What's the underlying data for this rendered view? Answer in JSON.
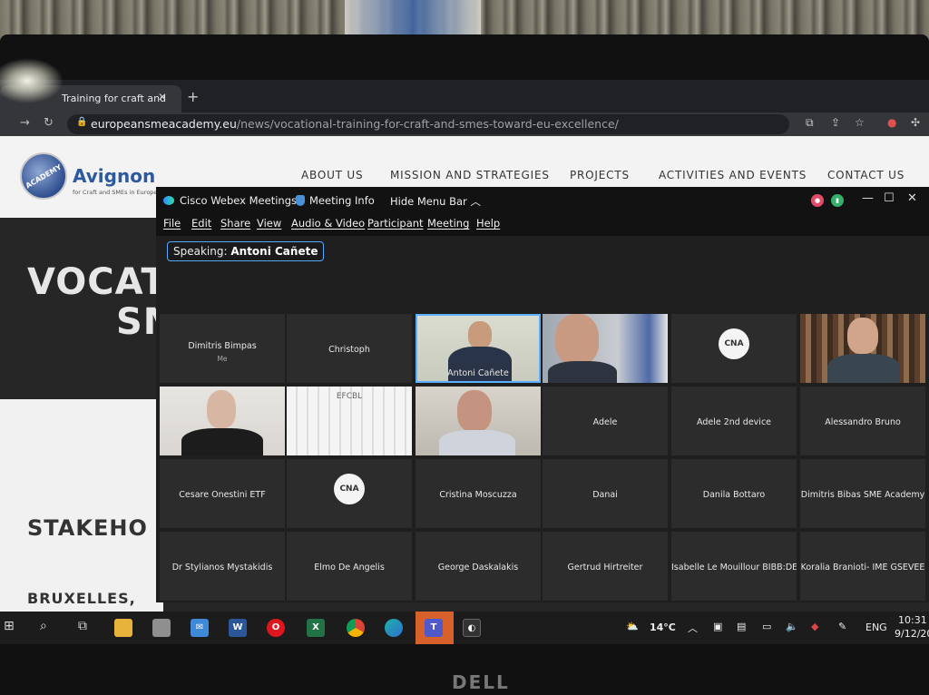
{
  "browser": {
    "tab_title": "Training for craft and",
    "url_host": "europeansmeacademy.eu",
    "url_path": "/news/vocational-training-for-craft-and-smes-toward-eu-excellence/"
  },
  "site": {
    "logo_mark": "ACADEMY",
    "logo_title": "Avignon",
    "logo_subtitle": "for Craft and SMEs in Europe",
    "nav": [
      "ABOUT US",
      "MISSION AND STRATEGIES",
      "PROJECTS",
      "ACTIVITIES AND EVENTS",
      "CONTACT US"
    ],
    "hero_line1": "VOCAT",
    "hero_line2": "SM",
    "stakeholders": "STAKEHO",
    "location": "BRUXELLES,"
  },
  "webex": {
    "app_title": "Cisco Webex Meetings",
    "meeting_info": "Meeting Info",
    "hide_menu": "Hide Menu Bar",
    "menu": [
      "File",
      "Edit",
      "Share",
      "View",
      "Audio & Video",
      "Participant",
      "Meeting",
      "Help"
    ],
    "speaking_label": "Speaking:",
    "speaking_name": "Antoni Cañete",
    "participants": [
      {
        "name": "Dimitris Bimpas",
        "sub": "Me",
        "kind": "name"
      },
      {
        "name": "Christoph",
        "sub": "",
        "kind": "name"
      },
      {
        "name": "Antoni Cañete",
        "sub": "",
        "kind": "video-speaker"
      },
      {
        "name": "",
        "sub": "",
        "kind": "video-man"
      },
      {
        "name": "CNA",
        "sub": "",
        "kind": "logo"
      },
      {
        "name": "",
        "sub": "",
        "kind": "video-elder"
      },
      {
        "name": "",
        "sub": "",
        "kind": "video-woman"
      },
      {
        "name": "EFCBL",
        "sub": "",
        "kind": "video-board"
      },
      {
        "name": "",
        "sub": "",
        "kind": "video-man2"
      },
      {
        "name": "Adele",
        "sub": "",
        "kind": "name"
      },
      {
        "name": "Adele 2nd device",
        "sub": "",
        "kind": "name"
      },
      {
        "name": "Alessandro Bruno",
        "sub": "",
        "kind": "name"
      },
      {
        "name": "Cesare Onestini ETF",
        "sub": "",
        "kind": "name"
      },
      {
        "name": "CNA",
        "sub": "",
        "kind": "logo"
      },
      {
        "name": "Cristina Moscuzza",
        "sub": "",
        "kind": "name"
      },
      {
        "name": "Danai",
        "sub": "",
        "kind": "name"
      },
      {
        "name": "Danila Bottaro",
        "sub": "",
        "kind": "name"
      },
      {
        "name": "Dimitris Bibas SME Academy",
        "sub": "",
        "kind": "name"
      },
      {
        "name": "Dr Stylianos Mystakidis",
        "sub": "",
        "kind": "name"
      },
      {
        "name": "Elmo De Angelis",
        "sub": "",
        "kind": "name"
      },
      {
        "name": "George Daskalakis",
        "sub": "",
        "kind": "name"
      },
      {
        "name": "Gertrud Hirtreiter",
        "sub": "",
        "kind": "name"
      },
      {
        "name": "Isabelle Le Mouillour BIBB:DE",
        "sub": "",
        "kind": "name"
      },
      {
        "name": "Koralia Branioti- IME GSEVEE",
        "sub": "",
        "kind": "name"
      }
    ]
  },
  "taskbar": {
    "apps": [
      "W",
      "X",
      "T"
    ],
    "temperature": "14°C",
    "language": "ENG",
    "time": "10:31",
    "date": "9/12/20"
  },
  "device_brand": "DELL"
}
